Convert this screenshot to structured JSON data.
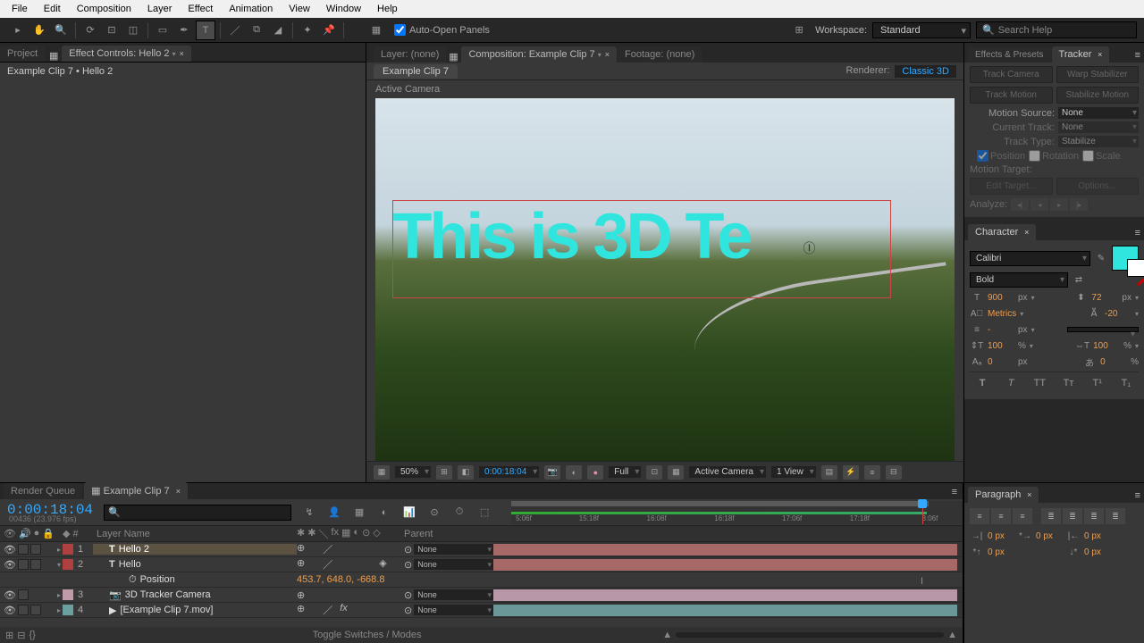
{
  "menu": [
    "File",
    "Edit",
    "Composition",
    "Layer",
    "Effect",
    "Animation",
    "View",
    "Window",
    "Help"
  ],
  "toolbar": {
    "autoOpen": "Auto-Open Panels",
    "workspace_label": "Workspace:",
    "workspace_value": "Standard",
    "search_placeholder": "Search Help"
  },
  "leftPanel": {
    "tabs": [
      "Project",
      "Effect Controls: Hello 2"
    ],
    "breadcrumb": "Example Clip 7 • Hello 2"
  },
  "centerPanel": {
    "tabs": [
      {
        "label": "Layer: (none)"
      },
      {
        "label": "Composition: Example Clip 7",
        "active": true
      },
      {
        "label": "Footage: (none)"
      }
    ],
    "subtab": "Example Clip 7",
    "renderer_label": "Renderer:",
    "renderer_value": "Classic 3D",
    "active_camera": "Active Camera",
    "overlay_text": "This is 3D Te",
    "controls": {
      "zoom": "50%",
      "timecode": "0:00:18:04",
      "resolution": "Full",
      "camera": "Active Camera",
      "views": "1 View"
    }
  },
  "tracker": {
    "tabs": [
      "Effects & Presets",
      "Tracker"
    ],
    "btns": [
      "Track Camera",
      "Warp Stabilizer",
      "Track Motion",
      "Stabilize Motion"
    ],
    "motion_source_label": "Motion Source:",
    "motion_source": "None",
    "current_track_label": "Current Track:",
    "current_track": "None",
    "track_type_label": "Track Type:",
    "track_type": "Stabilize",
    "checks": [
      "Position",
      "Rotation",
      "Scale"
    ],
    "motion_target_label": "Motion Target:",
    "edit_target": "Edit Target...",
    "options": "Options...",
    "analyze_label": "Analyze:"
  },
  "character": {
    "title": "Character",
    "font": "Calibri",
    "style": "Bold",
    "size": "900",
    "size_unit": "px",
    "leading": "72",
    "leading_unit": "px",
    "kerning": "Metrics",
    "tracking": "-20",
    "stroke": "-",
    "stroke_unit": "px",
    "vscale": "100",
    "vscale_unit": "%",
    "hscale": "100",
    "hscale_unit": "%",
    "baseline": "0",
    "baseline_unit": "px",
    "tsume": "0",
    "tsume_unit": "%"
  },
  "paragraph": {
    "title": "Paragraph",
    "indent_left": "0 px",
    "indent_right": "0 px",
    "indent_first": "0 px",
    "space_before": "0 px",
    "space_after": "0 px"
  },
  "timeline": {
    "tabs": [
      "Render Queue",
      "Example Clip 7"
    ],
    "timecode": "0:00:18:04",
    "subcode": "00436 (23.976 fps)",
    "cols": {
      "num": "#",
      "name": "Layer Name",
      "parent": "Parent"
    },
    "ruler": [
      "5:06f",
      "15:18f",
      "16:06f",
      "16:18f",
      "17:06f",
      "17:18f",
      "3:06f"
    ],
    "layers": [
      {
        "num": "1",
        "name": "Hello 2",
        "color": "#b04040",
        "parent": "None",
        "selected": true,
        "type": "T",
        "bar": "#a76868"
      },
      {
        "num": "2",
        "name": "Hello",
        "color": "#b04040",
        "parent": "None",
        "type": "T",
        "bar": "#a76868",
        "prop": "Position",
        "prop_val": "453.7, 648.0, -668.8"
      },
      {
        "num": "3",
        "name": "3D Tracker Camera",
        "color": "#c09aa8",
        "parent": "None",
        "type": "cam",
        "bar": "#b898a8"
      },
      {
        "num": "4",
        "name": "[Example Clip 7.mov]",
        "color": "#6aa0a0",
        "parent": "None",
        "type": "vid",
        "bar": "#6a9898"
      }
    ],
    "footer": "Toggle Switches / Modes"
  }
}
